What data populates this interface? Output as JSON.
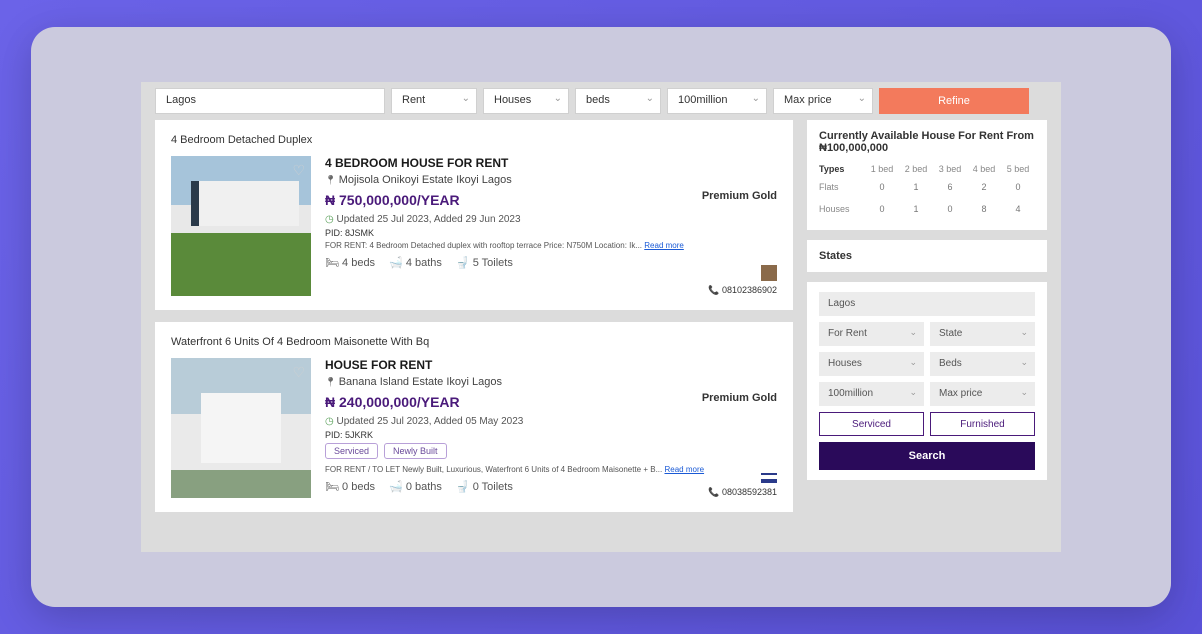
{
  "filters": {
    "location": "Lagos",
    "type": "Rent",
    "property": "Houses",
    "beds": "beds",
    "minPrice": "100million",
    "maxPrice": "Max price",
    "refine": "Refine"
  },
  "listings": [
    {
      "title": "4 Bedroom Detached Duplex",
      "heading": "4 BEDROOM HOUSE FOR RENT",
      "location": "Mojisola Onikoyi Estate Ikoyi Lagos",
      "price": "₦ 750,000,000/YEAR",
      "dates": "Updated 25 Jul 2023, Added 29 Jun 2023",
      "pid": "PID: 8JSMK",
      "desc": "FOR RENT: 4 Bedroom Detached duplex with rooftop terrace Price: N750M Location: Ik...",
      "readmore": "Read more",
      "beds": "4 beds",
      "baths": "4 baths",
      "toilets": "5 Toilets",
      "badge": "Premium Gold",
      "phone": "08102386902"
    },
    {
      "title": "Waterfront 6 Units Of 4 Bedroom Maisonette With Bq",
      "heading": "HOUSE FOR RENT",
      "location": "Banana Island Estate Ikoyi Lagos",
      "price": "₦ 240,000,000/YEAR",
      "dates": "Updated 25 Jul 2023, Added 05 May 2023",
      "pid": "PID: 5JKRK",
      "desc": "FOR RENT / TO LET Newly Built, Luxurious, Waterfront 6 Units of 4 Bedroom Maisonette + B...",
      "readmore": "Read more",
      "badges": [
        "Serviced",
        "Newly Built"
      ],
      "beds": "0 beds",
      "baths": "0 baths",
      "toilets": "0 Toilets",
      "badge": "Premium Gold",
      "phone": "08038592381"
    }
  ],
  "sidebar": {
    "currentHeading": "Currently Available House For Rent From ₦100,000,000",
    "typesLabel": "Types",
    "bedHeaders": [
      "1 bed",
      "2 bed",
      "3 bed",
      "4 bed",
      "5 bed"
    ],
    "rows": [
      {
        "label": "Flats",
        "vals": [
          "0",
          "1",
          "6",
          "2",
          "0"
        ]
      },
      {
        "label": "Houses",
        "vals": [
          "0",
          "1",
          "0",
          "8",
          "4"
        ]
      }
    ],
    "statesHeading": "States"
  },
  "miniForm": {
    "location": "Lagos",
    "purpose": "For Rent",
    "state": "State",
    "property": "Houses",
    "beds": "Beds",
    "minPrice": "100million",
    "maxPrice": "Max price",
    "serviced": "Serviced",
    "furnished": "Furnished",
    "search": "Search"
  }
}
